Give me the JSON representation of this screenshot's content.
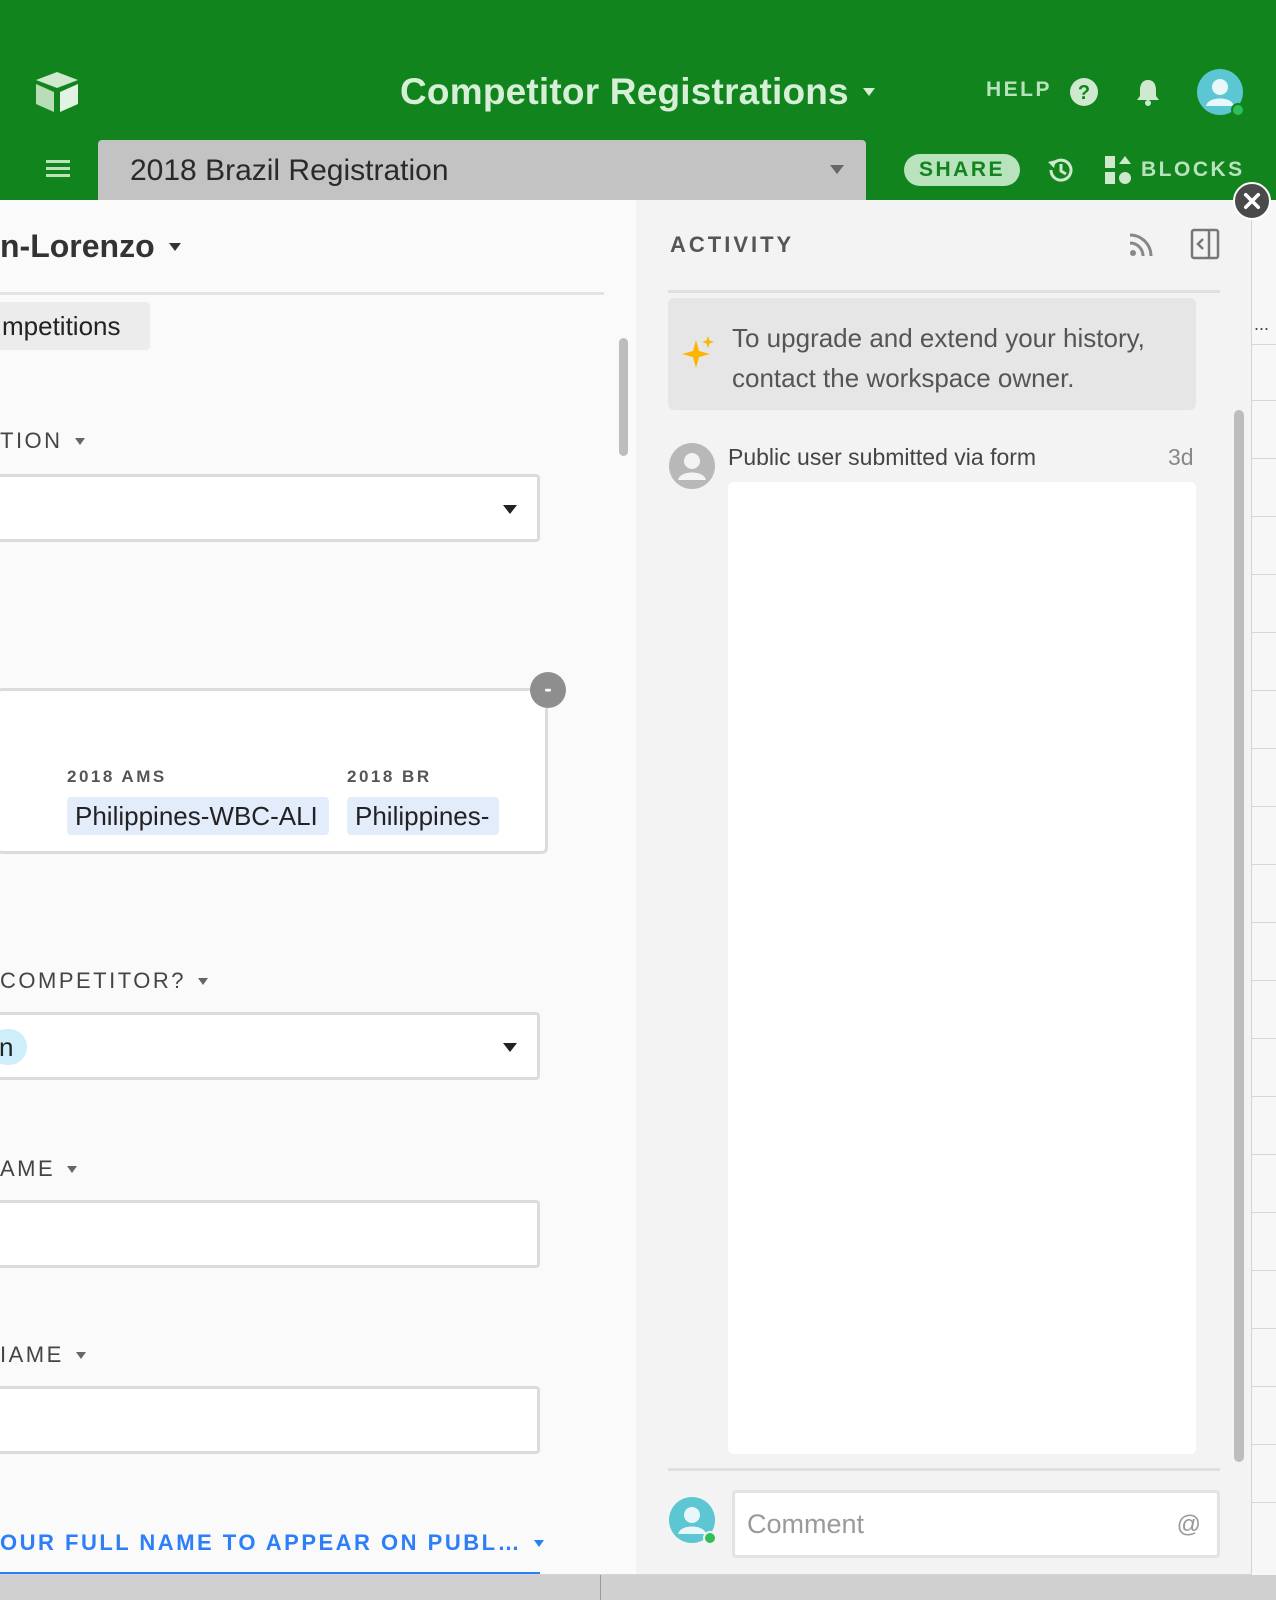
{
  "header": {
    "base_title": "Competitor Registrations",
    "help_label": "HELP",
    "table_name": "2018 Brazil Registration",
    "share_label": "SHARE",
    "blocks_label": "BLOCKS",
    "brand_color": "#11841e"
  },
  "record": {
    "title": "n-Lorenzo",
    "tab_label": "mpetitions",
    "fields": [
      {
        "label": "TION"
      },
      {
        "label": "COMPETITOR?",
        "value": "n"
      },
      {
        "label": "AME"
      },
      {
        "label": "IAME"
      },
      {
        "label": "OUR FULL NAME TO APPEAR ON PUBL…"
      }
    ],
    "linked": [
      {
        "header": "2018 AMS",
        "value": "Philippines-WBC-ALI"
      },
      {
        "header": "2018 BR",
        "value": "Philippines-"
      }
    ],
    "minus_label": "-"
  },
  "activity": {
    "title": "ACTIVITY",
    "upgrade_text": "To upgrade and extend your history, contact the workspace owner.",
    "entry_text": "Public user submitted via form",
    "entry_time": "3d",
    "comment_placeholder": "Comment",
    "mention_symbol": "@"
  },
  "background": {
    "overflow_dots": "..."
  }
}
